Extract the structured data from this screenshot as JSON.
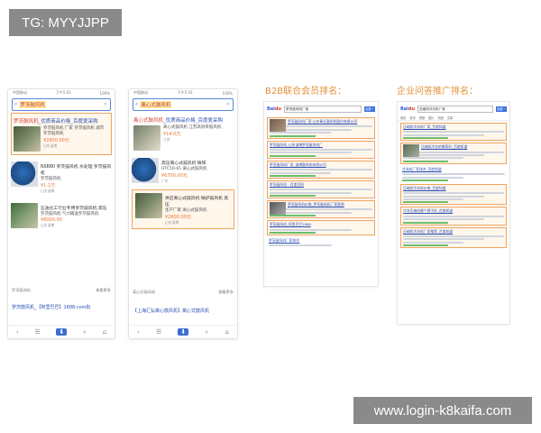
{
  "watermarks": {
    "top_left": "TG: MYYJJPP",
    "bottom_right": "www.login-k8kaifa.com"
  },
  "section_headings": {
    "b2b": "B2B联合会员排名：",
    "qa": "企业问答推广排名："
  },
  "phone1": {
    "status_left": "中国移动",
    "status_center": "下午5:41",
    "status_right": "100%",
    "search_query": "罗茨鼓风机",
    "results": [
      {
        "title_hl": "罗茨鼓风机",
        "title_rest": "_优质商品价格_百度爱采购",
        "desc": "罗茨鼓风机 厂家 罗茨鼓风机 城市 罗茨鼓风机",
        "price": "¥2800.00元",
        "meta": "山东淄博"
      },
      {
        "title_hl": "",
        "title_rest": "NSR80 罗茨鼓风机 水处理 罗茨鼓风机",
        "desc": "罗茨鼓风机",
        "price": "¥1.1万",
        "meta": "山东淄博"
      },
      {
        "title_hl": "",
        "title_rest": "石油化工行业专用罗茨鼓风机 高压",
        "desc": "罗茨鼓风机 气力输送罗茨鼓风机",
        "price": "¥8000.00",
        "meta": "山东淄博"
      }
    ],
    "more_left": "罗茨鼓风机",
    "more_right": "查看更多",
    "footer_link": "罗茨鼓风机_【阿里巴巴】1688.com批",
    "nav": [
      "‹",
      "☰",
      "⬇",
      "⌕",
      "⌂"
    ]
  },
  "phone2": {
    "status_left": "中国移动",
    "status_center": "下午5:41",
    "status_right": "100%",
    "search_query": "离心式鼓风机",
    "results": [
      {
        "title_hl": "离心式鼓风机",
        "title_rest": "_优质商品价格_百度爱采购",
        "desc": "离心式鼓风机 江苏高效率鼓风机",
        "price": "¥14.0万",
        "meta": "江苏"
      },
      {
        "title_hl": "",
        "title_rest": "高压离心式鼓风机 铸铁",
        "desc": "HTC50-65 离心式鼓风机",
        "price": "¥6700.00元",
        "meta": "广东"
      },
      {
        "title_hl": "",
        "title_rest": "供应离心式鼓风机 锅炉鼓风机 高压",
        "desc": "生产厂家 离心式鼓风机",
        "price": "¥2600.00元",
        "meta": "山东淄博"
      }
    ],
    "more_left": "离心式鼓风机",
    "more_right": "查看更多",
    "footer_link": "【上海汇弘离心鼓风机】离心式鼓风机",
    "nav": [
      "‹",
      "☰",
      "⬇",
      "⌕",
      "⌂"
    ]
  },
  "serp1": {
    "logo_a": "Bai",
    "logo_b": "du",
    "query": "罗茨鼓风机厂家",
    "button": "百度一下",
    "titles": [
      "罗茨鼓风机厂家 山东章丘鼓风机股份有限公司",
      "罗茨鼓风机_山东淄博罗茨鼓风机厂",
      "罗茨鼓风机厂家_淄博鼓风机有限公司",
      "罗茨鼓风机 - 百度百科",
      "罗茨鼓风机价格_罗茨鼓风机厂家直销",
      "罗茨鼓风机_阿里巴巴1688",
      "罗茨鼓风机厂家排名"
    ]
  },
  "serp2": {
    "logo_a": "Bai",
    "logo_b": "du",
    "query": "压缩机冷冻机厂家",
    "button": "百度一下",
    "tabs": [
      "网页",
      "资讯",
      "视频",
      "图片",
      "知道",
      "文库"
    ],
    "titles": [
      "压缩机冷冻机厂家_百度知道",
      "压缩机冷冻机哪家好_百度知道",
      "冷冻机厂家排名_百度知道",
      "压缩机冷冻机价格_百度知道",
      "冷冻压缩机哪个牌子好_百度知道",
      "压缩机冷冻机厂家推荐_百度知道"
    ]
  }
}
